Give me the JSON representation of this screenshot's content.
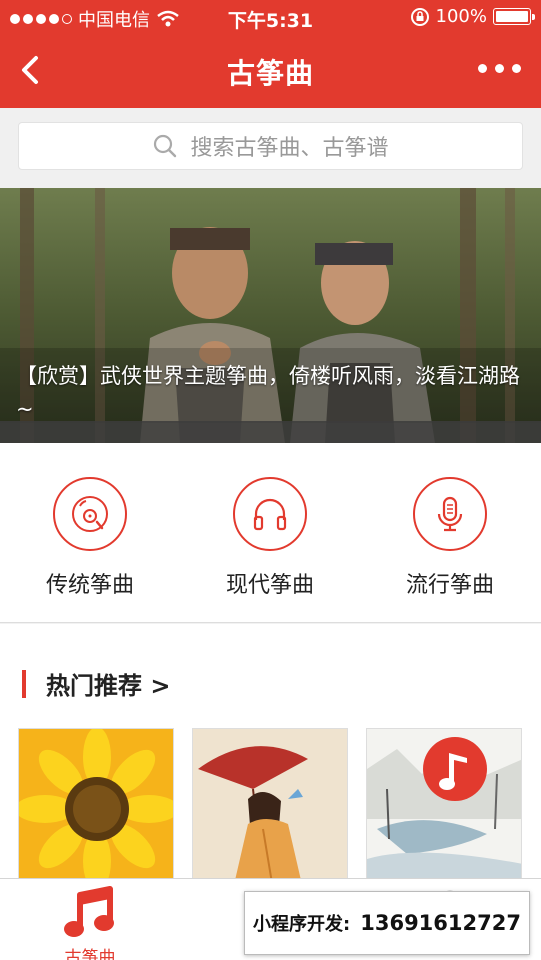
{
  "status_bar": {
    "carrier": "中国电信",
    "time": "下午5:31",
    "battery": "100%"
  },
  "nav": {
    "title": "古筝曲"
  },
  "search": {
    "placeholder": "搜索古筝曲、古筝谱"
  },
  "banner": {
    "caption": "【欣赏】武侠世界主题筝曲，倚楼听风雨，淡看江湖路~"
  },
  "categories": [
    {
      "label": "传统筝曲",
      "icon": "record-icon"
    },
    {
      "label": "现代筝曲",
      "icon": "headphones-icon"
    },
    {
      "label": "流行筝曲",
      "icon": "microphone-icon"
    }
  ],
  "hot": {
    "title": "热门推荐 >"
  },
  "tabbar": {
    "active_label": "古筝曲"
  },
  "ad": {
    "label": "小程序开发:",
    "phone": "13691612727"
  },
  "colors": {
    "accent": "#e23a2e"
  }
}
